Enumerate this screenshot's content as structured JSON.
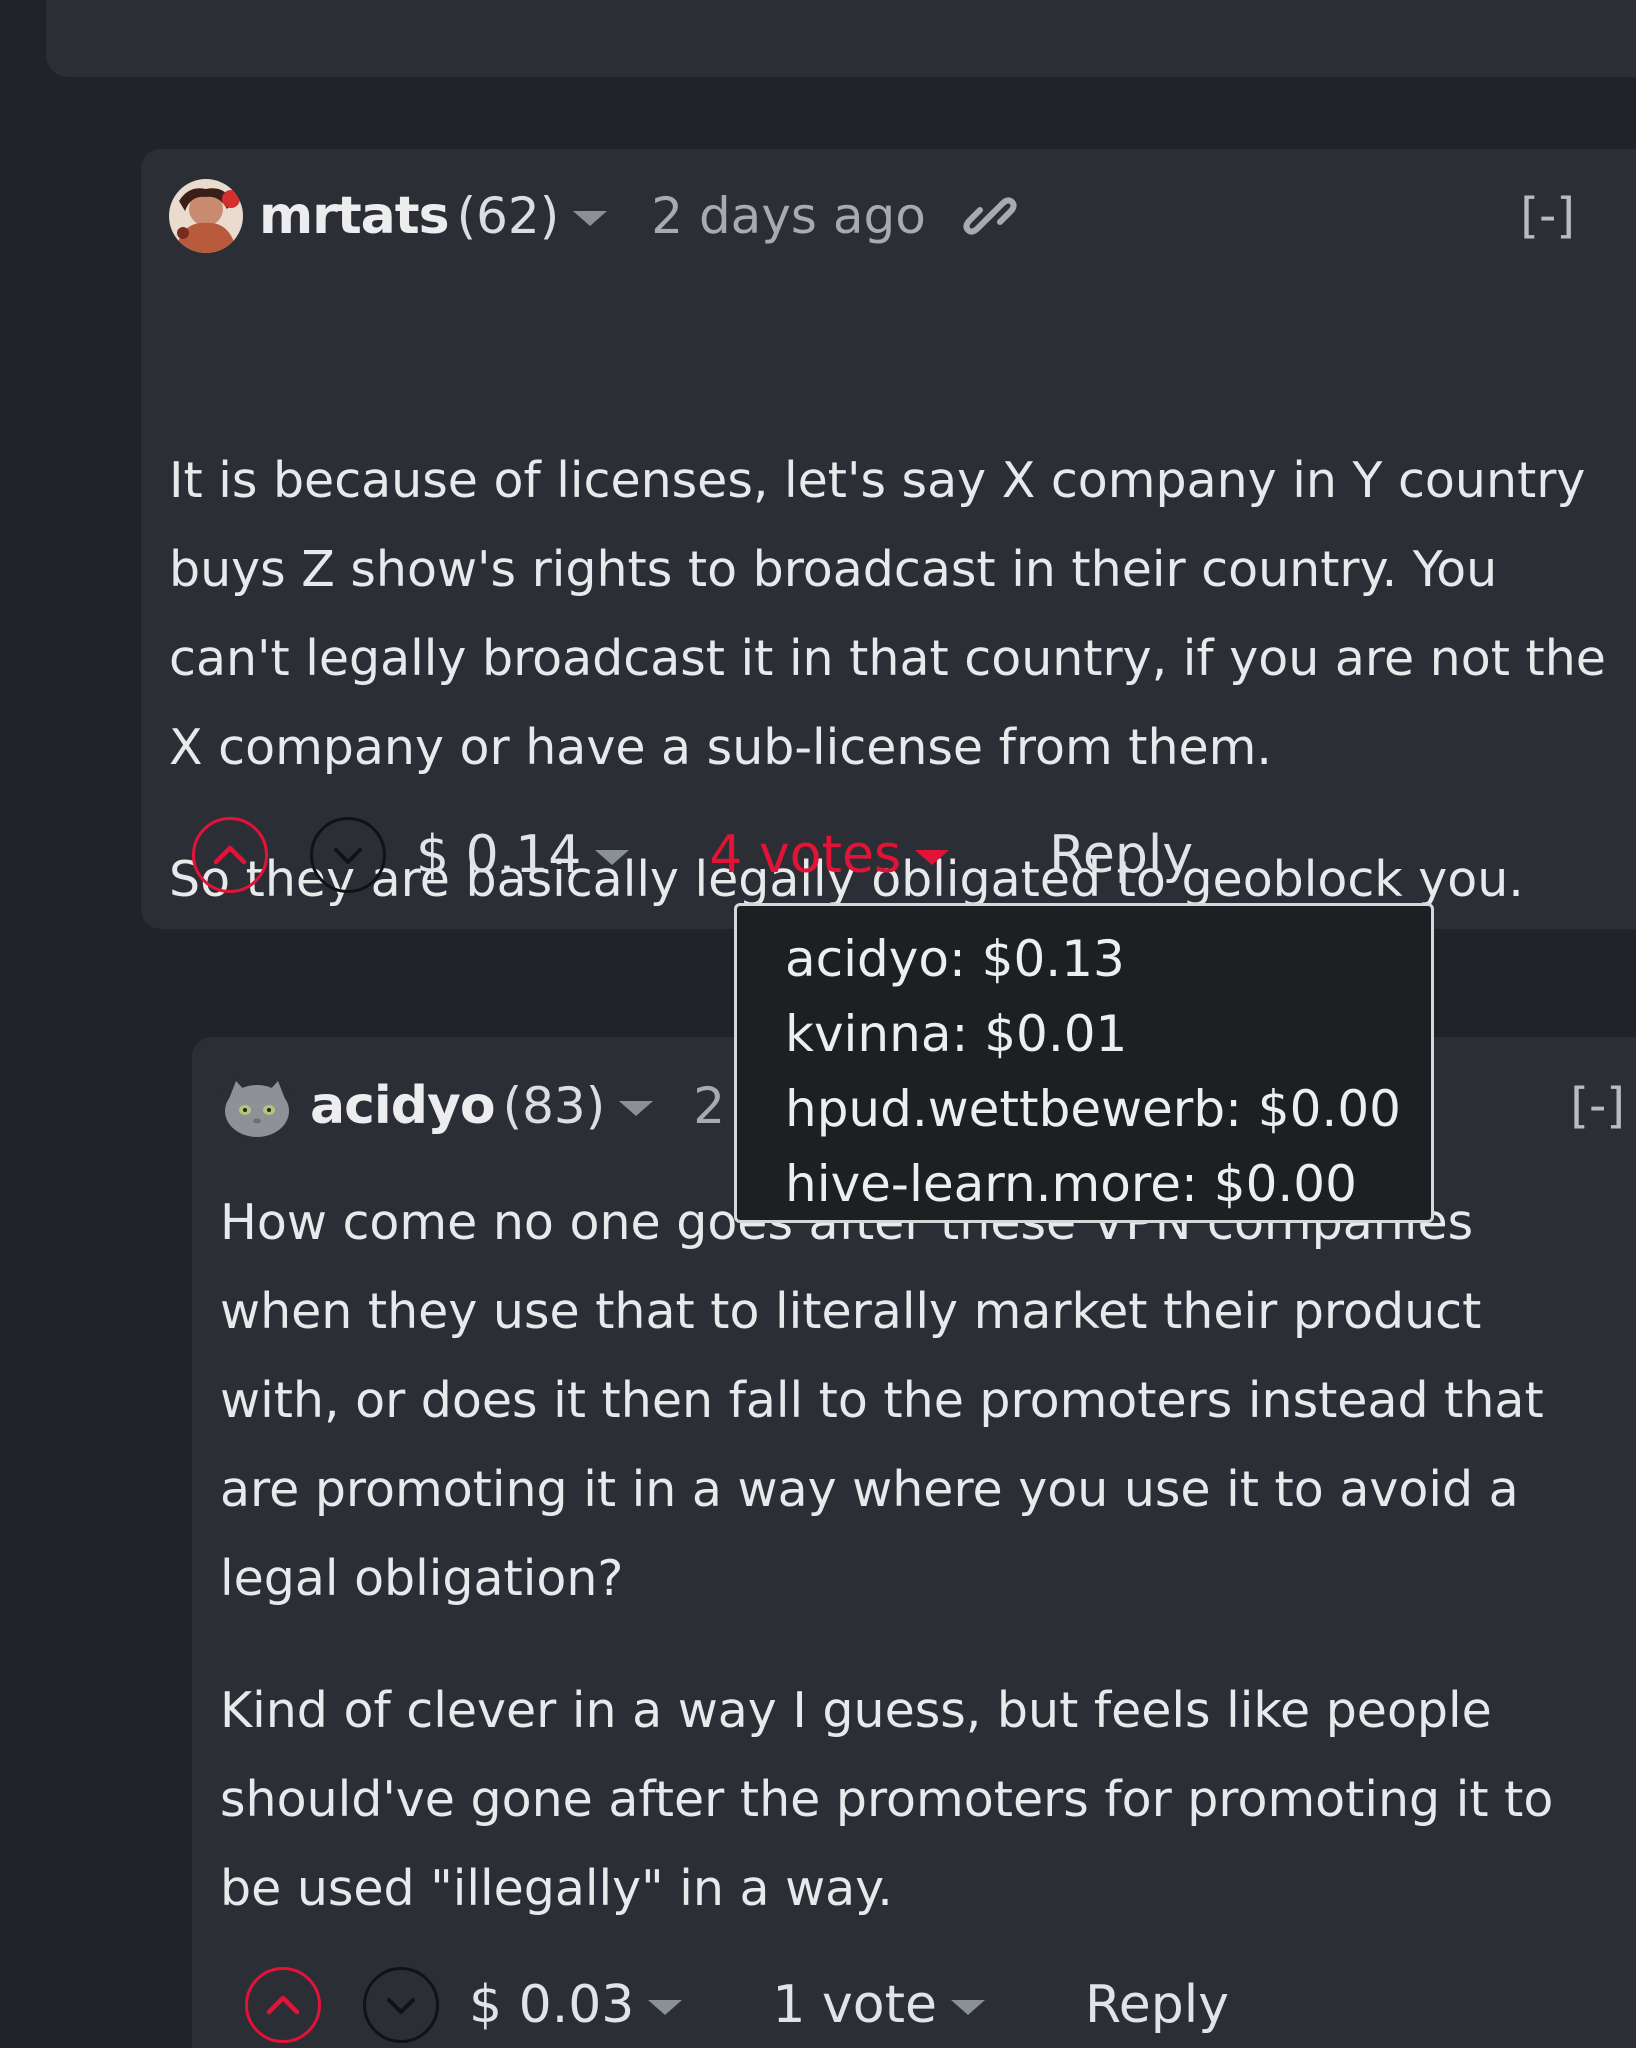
{
  "comments": [
    {
      "author": "mrtats",
      "reputation": "(62)",
      "age": "2 days ago",
      "collapse": "[-]",
      "paragraphs": [
        "It is because of licenses, let's say X company in Y country buys Z show's rights to broadcast in their country. You can't legally broadcast it in that country, if you are not the X company or have a sub-license from them.",
        "So they are basically legally obligated to geoblock you."
      ],
      "payout": "$ 0.14",
      "votes": "4 votes",
      "reply": "Reply"
    },
    {
      "author": "acidyo",
      "reputation": "(83)",
      "age": "2",
      "collapse": "[-]",
      "paragraphs": [
        "How come no one goes after these VPN companies when they use that to literally market their product with, or does it then fall to the promoters instead that are promoting it in a way where you use it to avoid a legal obligation?",
        "Kind of clever in a way I guess, but feels like people should've gone after the promoters for promoting it to be used \"illegally\" in a way."
      ],
      "payout": "$ 0.03",
      "votes": "1 vote",
      "reply": "Reply"
    }
  ],
  "votes_tooltip": [
    "acidyo: $0.13",
    "kvinna: $0.01",
    "hpud.wettbewerb: $0.00",
    "hive-learn.more: $0.00"
  ],
  "icons": {
    "upvote": "chevron-up-circle-icon",
    "downvote": "chevron-down-circle-icon",
    "permalink": "link-icon",
    "dropdown": "caret-down-icon"
  },
  "colors": {
    "background": "#202328",
    "card": "#2b2f35",
    "accent": "#e31337",
    "text": "#e8e9eb",
    "muted": "#a7abb1"
  }
}
